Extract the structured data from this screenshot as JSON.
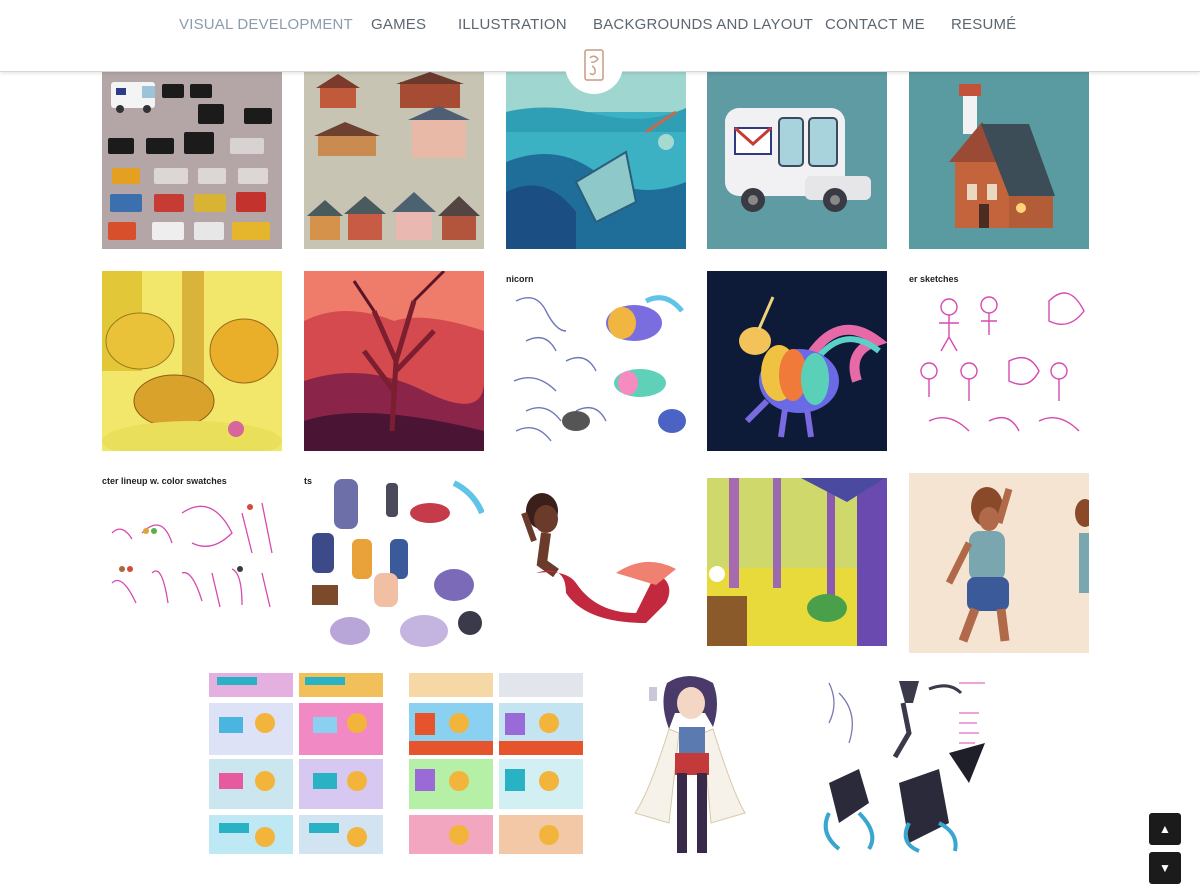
{
  "nav": {
    "items": [
      {
        "label": "VISUAL DEVELOPMENT",
        "active": true
      },
      {
        "label": "GAMES"
      },
      {
        "label": "ILLUSTRATION"
      },
      {
        "label": "BACKGROUNDS AND LAYOUT"
      },
      {
        "label": "CONTACT ME"
      },
      {
        "label": "RESUMÉ"
      }
    ],
    "active_color": "#8d9cac",
    "text_color": "#5c6670"
  },
  "gallery": {
    "captions": {
      "unicorn": "nicorn",
      "sketches": "er sketches",
      "lineup": "cter lineup w. color swatches",
      "characters": "ts"
    }
  },
  "controls": {
    "scroll_up_icon": "triangle-up-icon",
    "scroll_down_icon": "triangle-down-icon"
  }
}
